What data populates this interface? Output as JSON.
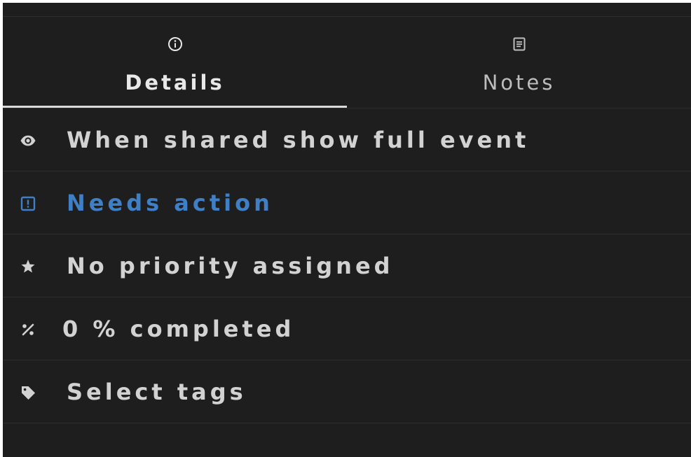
{
  "tabs": [
    {
      "label": "Details",
      "icon": "info-circle-icon",
      "active": true
    },
    {
      "label": "Notes",
      "icon": "notes-icon",
      "active": false
    }
  ],
  "rows": [
    {
      "label": "When shared show full event",
      "icon": "eye-icon"
    },
    {
      "label": "Needs action",
      "icon": "alert-square-icon",
      "color": "#3f7fc6"
    },
    {
      "label": "No priority assigned",
      "icon": "star-icon"
    },
    {
      "label": "0 % completed",
      "icon": "percent-icon"
    },
    {
      "label": "Select tags",
      "icon": "tag-icon"
    }
  ],
  "colors": {
    "background": "#1e1e1e",
    "text": "#d2d2d2",
    "accent": "#3f7fc6",
    "divider": "#2e2e2e"
  }
}
